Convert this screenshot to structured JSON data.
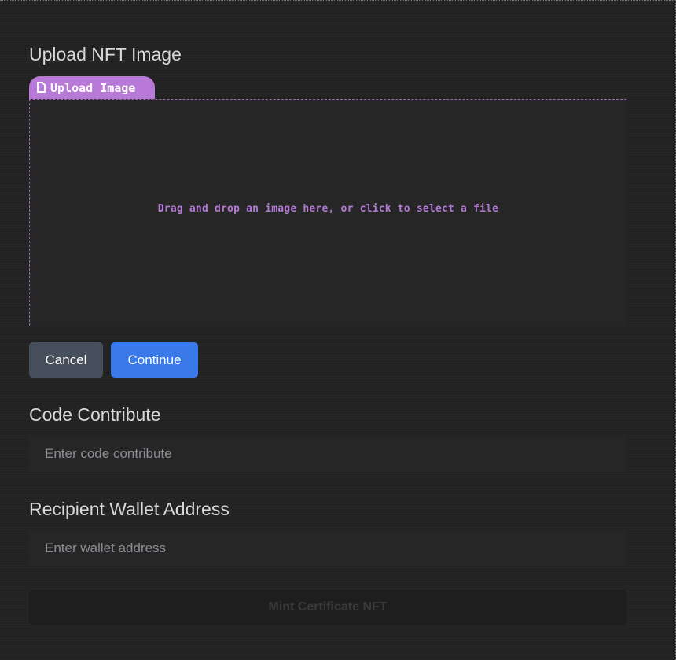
{
  "upload_section": {
    "title": "Upload NFT Image",
    "tab_label": "Upload Image",
    "tab_icon": "file-icon",
    "dropzone_text": "Drag and drop an image here, or click to select a file"
  },
  "actions": {
    "cancel_label": "Cancel",
    "continue_label": "Continue"
  },
  "code_contribute": {
    "title": "Code Contribute",
    "placeholder": "Enter code contribute",
    "value": ""
  },
  "wallet": {
    "title": "Recipient Wallet Address",
    "placeholder": "Enter wallet address",
    "value": ""
  },
  "mint": {
    "label": "Mint Certificate NFT",
    "disabled": true
  },
  "colors": {
    "background": "#232323",
    "accent_purple": "#b879d8",
    "primary_blue": "#3a79ea",
    "secondary_gray": "#46505c"
  }
}
